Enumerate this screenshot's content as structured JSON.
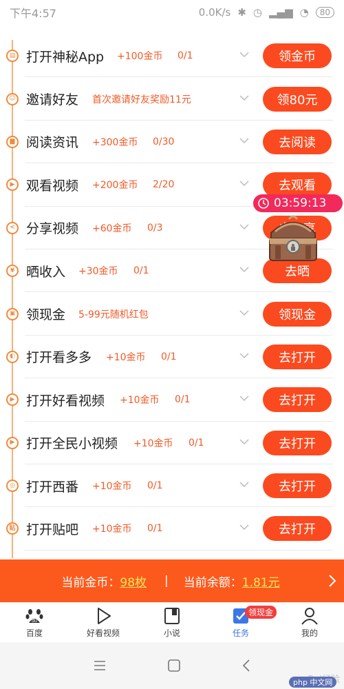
{
  "status_bar": {
    "time": "下午4:57",
    "network_speed": "0.0K/s",
    "battery": "80"
  },
  "tasks": [
    {
      "title": "打开神秘App",
      "reward": "+100金币",
      "progress": "0/1",
      "button": "领金币",
      "icon": "app-icon"
    },
    {
      "title": "邀请好友",
      "reward": "首次邀请好友奖励11元",
      "progress": "",
      "button": "领80元",
      "icon": "user-icon"
    },
    {
      "title": "阅读资讯",
      "reward": "+300金币",
      "progress": "0/30",
      "button": "去阅读",
      "icon": "document-icon"
    },
    {
      "title": "观看视频",
      "reward": "+200金币",
      "progress": "2/20",
      "button": "去观看",
      "icon": "play-icon"
    },
    {
      "title": "分享视频",
      "reward": "+60金币",
      "progress": "0/3",
      "button": "去分享",
      "icon": "share-icon"
    },
    {
      "title": "晒收入",
      "reward": "+30金币",
      "progress": "0/1",
      "button": "去晒",
      "icon": "yen-icon"
    },
    {
      "title": "领现金",
      "reward": "5-99元随机红包",
      "progress": "",
      "button": "领现金",
      "icon": "lock-icon"
    },
    {
      "title": "打开看多多",
      "reward": "+10金币",
      "progress": "0/1",
      "button": "去打开",
      "icon": "kanduoduo-icon"
    },
    {
      "title": "打开好看视频",
      "reward": "+10金币",
      "progress": "0/1",
      "button": "去打开",
      "icon": "play-icon"
    },
    {
      "title": "打开全民小视频",
      "reward": "+10金币",
      "progress": "0/1",
      "button": "去打开",
      "icon": "play-icon"
    },
    {
      "title": "打开西番",
      "reward": "+10金币",
      "progress": "0/1",
      "button": "去打开",
      "icon": "xifan-icon"
    },
    {
      "title": "打开贴吧",
      "reward": "+10金币",
      "progress": "0/1",
      "button": "去打开",
      "icon": "tieba-icon"
    }
  ],
  "timer": {
    "value": "03:59:13"
  },
  "coin_bar": {
    "coins_label": "当前金币：",
    "coins_value": "98枚",
    "separator": "|",
    "balance_label": "当前余额：",
    "balance_value": "1.81元"
  },
  "bottom_nav": {
    "items": [
      {
        "label": "百度",
        "icon": "baidu-paw-icon"
      },
      {
        "label": "好看视频",
        "icon": "play-icon"
      },
      {
        "label": "小说",
        "icon": "book-icon"
      },
      {
        "label": "任务",
        "icon": "task-check-icon",
        "active": true
      },
      {
        "label": "我的",
        "icon": "profile-icon"
      }
    ],
    "badge": "领现金"
  },
  "watermark": "Bai经验",
  "php_mark": "php 中文网",
  "colors": {
    "accent": "#fb4a1f",
    "reward_text": "#f05a28",
    "timeline": "#f6b07c",
    "coin_bar": "#fb5a1c",
    "coin_value": "#ffe45a",
    "timer": "#f2295b",
    "nav_active": "#3a78e6"
  }
}
